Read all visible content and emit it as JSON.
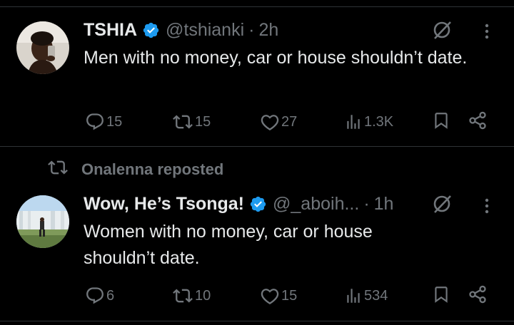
{
  "tweets": [
    {
      "name": "TSHIA",
      "handle": "@tshianki",
      "separator": "·",
      "time": "2h",
      "text": "Men with no money, car or house shouldn’t date.",
      "stats": {
        "replies": "15",
        "reposts": "15",
        "likes": "27",
        "views": "1.3K"
      }
    },
    {
      "repost_note": "Onalenna reposted",
      "name": "Wow, He’s Tsonga!",
      "handle": "@_aboih...",
      "separator": "·",
      "time": "1h",
      "text": "Women with no money, car or house shouldn’t date.",
      "stats": {
        "replies": "6",
        "reposts": "10",
        "likes": "15",
        "views": "534"
      }
    }
  ],
  "colors": {
    "background": "#000000",
    "text": "#e7e9ea",
    "muted": "#71767b",
    "verified": "#1d9bf0",
    "divider": "#2f3336"
  },
  "icons": [
    "verified-badge-icon",
    "grok-icon",
    "more-icon",
    "reply-icon",
    "repost-icon",
    "like-icon",
    "views-icon",
    "bookmark-icon",
    "share-icon"
  ]
}
